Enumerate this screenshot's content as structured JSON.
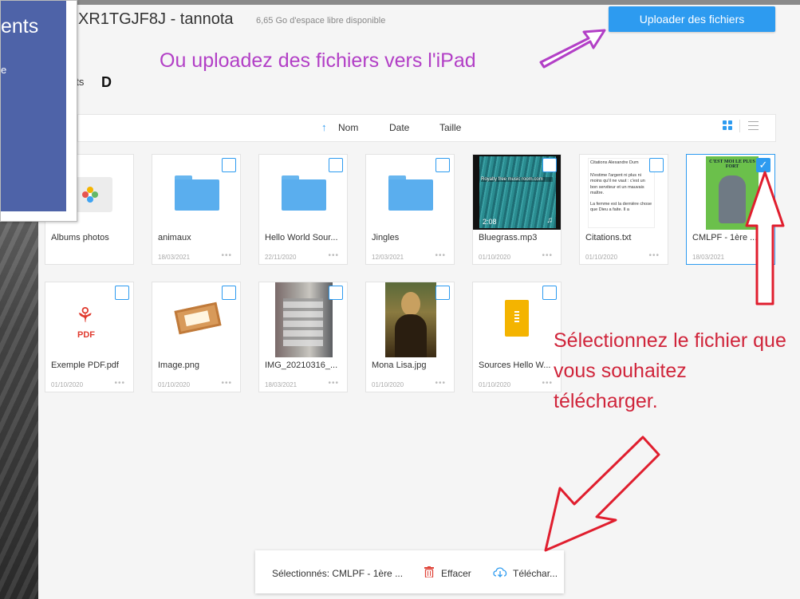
{
  "overlay_panel": {
    "title": "ents",
    "subtitle": "e"
  },
  "header": {
    "device_name": "XR1TGJF8J - tannota",
    "free_space": "6,65 Go d'espace libre disponible",
    "upload_button": "Uploader des fichiers"
  },
  "breadcrumb": {
    "label": "nts",
    "logo": "D"
  },
  "sortbar": {
    "sort_arrow": "↑",
    "name": "Nom",
    "date": "Date",
    "size": "Taille"
  },
  "files": [
    {
      "name": "Albums photos",
      "date": ""
    },
    {
      "name": "animaux",
      "date": "18/03/2021"
    },
    {
      "name": "Hello World Sour...",
      "date": "22/11/2020"
    },
    {
      "name": "Jingles",
      "date": "12/03/2021"
    },
    {
      "name": "Bluegrass.mp3",
      "date": "01/10/2020",
      "thumb_text": "Royalty free music room.com",
      "duration": "2:08"
    },
    {
      "name": "Citations.txt",
      "date": "01/10/2020",
      "thumb_lines": [
        "Citations Alexandre Dum",
        "N'estime l'argent ni plus ni moins qu'il ne vaut : c'est un bon serviteur et un mauvais maître.",
        "La femme est la dernière chose que Dieu a faite. Il a"
      ]
    },
    {
      "name": "CMLPF - 1ère ...",
      "date": "18/03/2021",
      "selected": true,
      "thumb_text": "C'EST MOI LE PLUS FORT"
    },
    {
      "name": "Exemple PDF.pdf",
      "date": "01/10/2020",
      "badge": "PDF"
    },
    {
      "name": "Image.png",
      "date": "01/10/2020"
    },
    {
      "name": "IMG_20210316_...",
      "date": "18/03/2021"
    },
    {
      "name": "Mona Lisa.jpg",
      "date": "01/10/2020"
    },
    {
      "name": "Sources Hello W...",
      "date": "01/10/2020"
    }
  ],
  "dots": "•••",
  "annotations": {
    "upload_hint": "Ou uploadez des fichiers vers l'iPad",
    "select_hint": "Sélectionnez le fichier que vous souhaitez télécharger."
  },
  "bottombar": {
    "selected": "Sélectionnés: CMLPF - 1ère ...",
    "delete": "Effacer",
    "download": "Téléchar..."
  },
  "colors": {
    "accent": "#2d9bf0",
    "annotation_purple": "#b23fc6",
    "annotation_red": "#d0253b",
    "panel_blue": "#4e63a8"
  }
}
